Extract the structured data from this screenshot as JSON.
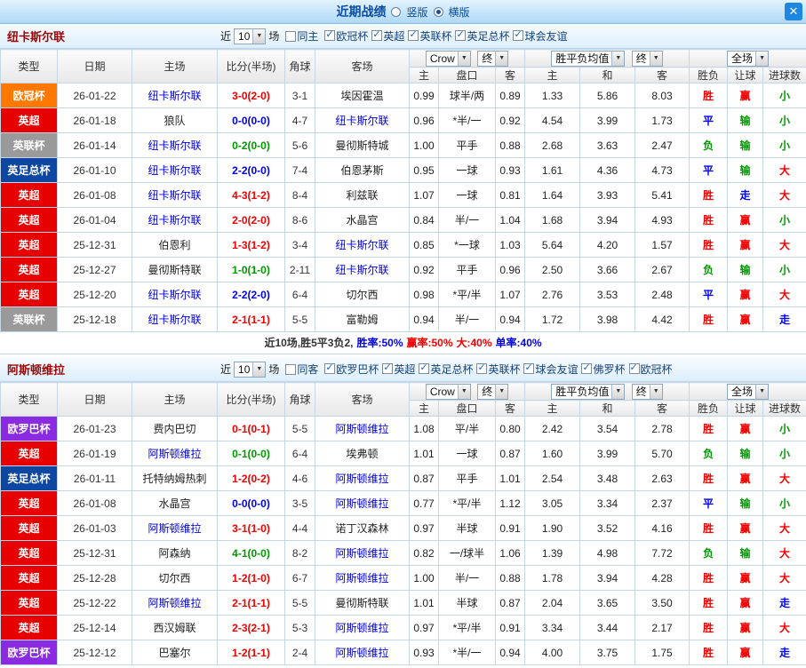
{
  "titlebar": {
    "title": "近期战绩",
    "radio_vertical": "竖版",
    "radio_horizontal": "横版",
    "close": "✕"
  },
  "filter": {
    "near": "近",
    "games_value": "10",
    "games_suffix": "场"
  },
  "columns": {
    "type": "类型",
    "date": "日期",
    "home": "主场",
    "score": "比分(半场)",
    "corner": "角球",
    "away": "客场",
    "odds_home": "主",
    "odds_line": "盘口",
    "odds_away": "客",
    "avg_home": "主",
    "avg_draw": "和",
    "avg_away": "客",
    "outcome": "胜负",
    "handicap": "让球",
    "goals": "进球数",
    "bookmaker_select": "Crow",
    "final_select": "终",
    "avg_select": "胜平负均值",
    "scope_select": "全场"
  },
  "colors": {
    "league": {
      "欧冠杯": "#ff7800",
      "英超": "#e60000",
      "英联杯": "#9a9a9a",
      "英足总杯": "#0d47a1",
      "欧罗巴杯": "#8a2be2"
    },
    "result": {
      "win": "#f00000",
      "draw": "#0000ee",
      "lose": "#009900"
    },
    "outcome": {
      "胜": "#f00000",
      "平": "#0000ee",
      "负": "#009900"
    },
    "handicap": {
      "赢": "#f00000",
      "走": "#0000ee",
      "输": "#009900"
    },
    "goals": {
      "大": "#f00000",
      "走": "#0000ee",
      "小": "#009900"
    },
    "focal_team": "#0000ee",
    "opponent": "#222222"
  },
  "sections": [
    {
      "team": "纽卡斯尔联",
      "same_venue_label": "同主",
      "leagues": [
        "欧冠杯",
        "英超",
        "英联杯",
        "英足总杯",
        "球会友谊"
      ],
      "rows": [
        {
          "league": "欧冠杯",
          "date": "26-01-22",
          "home": "纽卡斯尔联",
          "score": "3-0(2-0)",
          "result": "win",
          "corners": "3-1",
          "away": "埃因霍温",
          "odds": [
            "0.99",
            "球半/两",
            "0.89"
          ],
          "avg": [
            "1.33",
            "5.86",
            "8.03"
          ],
          "outcome": "胜",
          "handicap": "赢",
          "goals": "小"
        },
        {
          "league": "英超",
          "date": "26-01-18",
          "home": "狼队",
          "score": "0-0(0-0)",
          "result": "draw",
          "corners": "4-7",
          "away": "纽卡斯尔联",
          "odds": [
            "0.96",
            "*半/一",
            "0.92"
          ],
          "avg": [
            "4.54",
            "3.99",
            "1.73"
          ],
          "outcome": "平",
          "handicap": "输",
          "goals": "小"
        },
        {
          "league": "英联杯",
          "date": "26-01-14",
          "home": "纽卡斯尔联",
          "score": "0-2(0-0)",
          "result": "lose",
          "corners": "5-6",
          "away": "曼彻斯特城",
          "odds": [
            "1.00",
            "平手",
            "0.88"
          ],
          "avg": [
            "2.68",
            "3.63",
            "2.47"
          ],
          "outcome": "负",
          "handicap": "输",
          "goals": "小"
        },
        {
          "league": "英足总杯",
          "date": "26-01-10",
          "home": "纽卡斯尔联",
          "score": "2-2(0-0)",
          "result": "draw",
          "corners": "7-4",
          "away": "伯恩茅斯",
          "odds": [
            "0.95",
            "一球",
            "0.93"
          ],
          "avg": [
            "1.61",
            "4.36",
            "4.73"
          ],
          "outcome": "平",
          "handicap": "输",
          "goals": "大"
        },
        {
          "league": "英超",
          "date": "26-01-08",
          "home": "纽卡斯尔联",
          "score": "4-3(1-2)",
          "result": "win",
          "corners": "8-4",
          "away": "利兹联",
          "odds": [
            "1.07",
            "一球",
            "0.81"
          ],
          "avg": [
            "1.64",
            "3.93",
            "5.41"
          ],
          "outcome": "胜",
          "handicap": "走",
          "goals": "大"
        },
        {
          "league": "英超",
          "date": "26-01-04",
          "home": "纽卡斯尔联",
          "score": "2-0(2-0)",
          "result": "win",
          "corners": "8-6",
          "away": "水晶宫",
          "odds": [
            "0.84",
            "半/一",
            "1.04"
          ],
          "avg": [
            "1.68",
            "3.94",
            "4.93"
          ],
          "outcome": "胜",
          "handicap": "赢",
          "goals": "小"
        },
        {
          "league": "英超",
          "date": "25-12-31",
          "home": "伯恩利",
          "score": "1-3(1-2)",
          "result": "win",
          "corners": "3-4",
          "away": "纽卡斯尔联",
          "odds": [
            "0.85",
            "*一球",
            "1.03"
          ],
          "avg": [
            "5.64",
            "4.20",
            "1.57"
          ],
          "outcome": "胜",
          "handicap": "赢",
          "goals": "大"
        },
        {
          "league": "英超",
          "date": "25-12-27",
          "home": "曼彻斯特联",
          "score": "1-0(1-0)",
          "result": "lose",
          "corners": "2-11",
          "away": "纽卡斯尔联",
          "odds": [
            "0.92",
            "平手",
            "0.96"
          ],
          "avg": [
            "2.50",
            "3.66",
            "2.67"
          ],
          "outcome": "负",
          "handicap": "输",
          "goals": "小"
        },
        {
          "league": "英超",
          "date": "25-12-20",
          "home": "纽卡斯尔联",
          "score": "2-2(2-0)",
          "result": "draw",
          "corners": "6-4",
          "away": "切尔西",
          "odds": [
            "0.98",
            "*平/半",
            "1.07"
          ],
          "avg": [
            "2.76",
            "3.53",
            "2.48"
          ],
          "outcome": "平",
          "handicap": "赢",
          "goals": "大"
        },
        {
          "league": "英联杯",
          "date": "25-12-18",
          "home": "纽卡斯尔联",
          "score": "2-1(1-1)",
          "result": "win",
          "corners": "5-5",
          "away": "富勒姆",
          "odds": [
            "0.94",
            "半/一",
            "0.94"
          ],
          "avg": [
            "1.72",
            "3.98",
            "4.42"
          ],
          "outcome": "胜",
          "handicap": "赢",
          "goals": "走"
        }
      ],
      "summary": [
        {
          "text": "近10场,胜5平3负2,",
          "color": "#333333"
        },
        {
          "text": "胜率:50%",
          "color": "#0000ee"
        },
        {
          "text": "赢率:50%",
          "color": "#f00000"
        },
        {
          "text": "大:40%",
          "color": "#f00000"
        },
        {
          "text": "单率:40%",
          "color": "#0000ee"
        }
      ]
    },
    {
      "team": "阿斯顿维拉",
      "same_venue_label": "同客",
      "leagues": [
        "欧罗巴杯",
        "英超",
        "英足总杯",
        "英联杯",
        "球会友谊",
        "佛罗杯",
        "欧冠杯"
      ],
      "rows": [
        {
          "league": "欧罗巴杯",
          "date": "26-01-23",
          "home": "费内巴切",
          "score": "0-1(0-1)",
          "result": "win",
          "corners": "5-5",
          "away": "阿斯顿维拉",
          "odds": [
            "1.08",
            "平/半",
            "0.80"
          ],
          "avg": [
            "2.42",
            "3.54",
            "2.78"
          ],
          "outcome": "胜",
          "handicap": "赢",
          "goals": "小"
        },
        {
          "league": "英超",
          "date": "26-01-19",
          "home": "阿斯顿维拉",
          "score": "0-1(0-0)",
          "result": "lose",
          "corners": "6-4",
          "away": "埃弗顿",
          "odds": [
            "1.01",
            "一球",
            "0.87"
          ],
          "avg": [
            "1.60",
            "3.99",
            "5.70"
          ],
          "outcome": "负",
          "handicap": "输",
          "goals": "小"
        },
        {
          "league": "英足总杯",
          "date": "26-01-11",
          "home": "托特纳姆热刺",
          "score": "1-2(0-2)",
          "result": "win",
          "corners": "4-6",
          "away": "阿斯顿维拉",
          "odds": [
            "0.87",
            "平手",
            "1.01"
          ],
          "avg": [
            "2.54",
            "3.48",
            "2.63"
          ],
          "outcome": "胜",
          "handicap": "赢",
          "goals": "大"
        },
        {
          "league": "英超",
          "date": "26-01-08",
          "home": "水晶宫",
          "score": "0-0(0-0)",
          "result": "draw",
          "corners": "3-5",
          "away": "阿斯顿维拉",
          "odds": [
            "0.77",
            "*平/半",
            "1.12"
          ],
          "avg": [
            "3.05",
            "3.34",
            "2.37"
          ],
          "outcome": "平",
          "handicap": "输",
          "goals": "小"
        },
        {
          "league": "英超",
          "date": "26-01-03",
          "home": "阿斯顿维拉",
          "score": "3-1(1-0)",
          "result": "win",
          "corners": "4-4",
          "away": "诺丁汉森林",
          "odds": [
            "0.97",
            "半球",
            "0.91"
          ],
          "avg": [
            "1.90",
            "3.52",
            "4.16"
          ],
          "outcome": "胜",
          "handicap": "赢",
          "goals": "大"
        },
        {
          "league": "英超",
          "date": "25-12-31",
          "home": "阿森纳",
          "score": "4-1(0-0)",
          "result": "lose",
          "corners": "8-2",
          "away": "阿斯顿维拉",
          "odds": [
            "0.82",
            "一/球半",
            "1.06"
          ],
          "avg": [
            "1.39",
            "4.98",
            "7.72"
          ],
          "outcome": "负",
          "handicap": "输",
          "goals": "大"
        },
        {
          "league": "英超",
          "date": "25-12-28",
          "home": "切尔西",
          "score": "1-2(1-0)",
          "result": "win",
          "corners": "6-7",
          "away": "阿斯顿维拉",
          "odds": [
            "1.00",
            "半/一",
            "0.88"
          ],
          "avg": [
            "1.78",
            "3.94",
            "4.28"
          ],
          "outcome": "胜",
          "handicap": "赢",
          "goals": "大"
        },
        {
          "league": "英超",
          "date": "25-12-22",
          "home": "阿斯顿维拉",
          "score": "2-1(1-1)",
          "result": "win",
          "corners": "5-5",
          "away": "曼彻斯特联",
          "odds": [
            "1.01",
            "半球",
            "0.87"
          ],
          "avg": [
            "2.04",
            "3.65",
            "3.50"
          ],
          "outcome": "胜",
          "handicap": "赢",
          "goals": "走"
        },
        {
          "league": "英超",
          "date": "25-12-14",
          "home": "西汉姆联",
          "score": "2-3(2-1)",
          "result": "win",
          "corners": "5-3",
          "away": "阿斯顿维拉",
          "odds": [
            "0.97",
            "*平/半",
            "0.91"
          ],
          "avg": [
            "3.34",
            "3.44",
            "2.17"
          ],
          "outcome": "胜",
          "handicap": "赢",
          "goals": "大"
        },
        {
          "league": "欧罗巴杯",
          "date": "25-12-12",
          "home": "巴塞尔",
          "score": "1-2(1-1)",
          "result": "win",
          "corners": "2-4",
          "away": "阿斯顿维拉",
          "odds": [
            "0.93",
            "*半/一",
            "0.94"
          ],
          "avg": [
            "4.00",
            "3.75",
            "1.75"
          ],
          "outcome": "胜",
          "handicap": "赢",
          "goals": "走"
        }
      ],
      "summary": []
    }
  ]
}
